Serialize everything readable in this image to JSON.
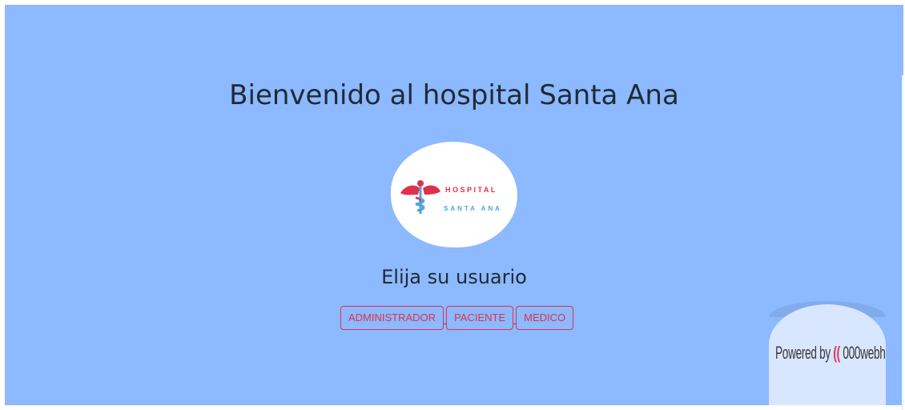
{
  "page": {
    "title": "Bienvenido al hospital Santa Ana",
    "subtitle": "Elija su usuario"
  },
  "logo": {
    "line1": "HOSPITAL",
    "line2": "SANTA ANA",
    "icon": "caduceus-icon",
    "colors": {
      "line1": "#e0314b",
      "line2": "#4fa3e0",
      "background": "#ffffff"
    }
  },
  "roles": [
    {
      "label": "ADMINISTRADOR"
    },
    {
      "label": "PACIENTE"
    },
    {
      "label": "MEDICO"
    }
  ],
  "badge": {
    "powered_by": "Powered by",
    "brand": "000webhost",
    "icon": "webhost-logo-icon"
  },
  "colors": {
    "background": "#8cb9ff",
    "accent": "#e0314b",
    "text": "#1f2a33"
  }
}
